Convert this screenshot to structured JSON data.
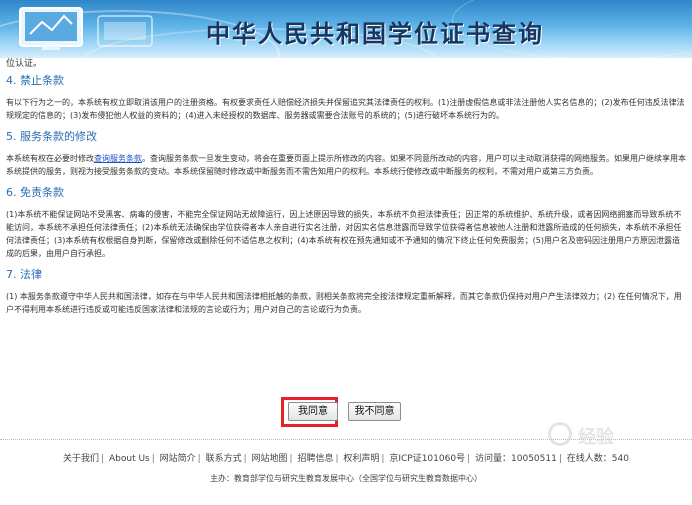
{
  "header": {
    "title": "中华人民共和国学位证书查询"
  },
  "content": {
    "top_fragment": "位认证。",
    "sections": [
      {
        "heading": "4. 禁止条款",
        "text": "有以下行为之一的，本系统有权立即取消该用户的注册资格。有权要求责任人赔偿经济损失并保留追究其法律责任的权利。(1)注册虚假信息或非法注册他人实名信息的；(2)发布任何违反法律法规规定的信息的；(3)发布侵犯他人权益的资料的；(4)进入未经授权的数据库、服务器或需要合法账号的系统的；(5)进行破坏本系统行为的。"
      },
      {
        "heading": "5. 服务条款的修改",
        "text_before_link": "本系统有权在必要时修改",
        "link": "查询服务条款",
        "text_after_link": "。查询服务条款一旦发生变动，将会在重要页面上提示所修改的内容。如果不同意所改动的内容，用户可以主动取消获得的网络服务。如果用户继续享用本系统提供的服务，则视为接受服务条款的变动。本系统保留随时修改或中断服务而不需告知用户的权利。本系统行使修改或中断服务的权利，不需对用户或第三方负责。"
      },
      {
        "heading": "6. 免责条款",
        "text": "(1)本系统不能保证网站不受黑客、病毒的侵害，不能完全保证网站无故障运行，因上述原因导致的损失，本系统不负担法律责任；因正常的系统维护、系统升级，或者因网络拥塞而导致系统不能访问，本系统不承担任何法律责任；(2)本系统无法确保由学位获得者本人亲自进行实名注册，对因实名信息泄露而导致学位获得者信息被他人注册和泄露所造成的任何损失，本系统不承担任何法律责任；(3)本系统有权根据自身判断，保留修改或删除任何不适信息之权利；(4)本系统有权在预先通知或不予通知的情况下终止任何免费服务；(5)用户名及密码因注册用户方原因泄露造成的后果，由用户自行承担。"
      },
      {
        "heading": "7. 法律",
        "text": "(1) 本服务条款遵守中华人民共和国法律，如存在与中华人民共和国法律相抵触的条款，则相关条款将完全按法律规定重新解释，而其它条款仍保持对用户产生法律效力；(2) 在任何情况下，用户不得利用本系统进行违反或可能违反国家法律和法规的言论或行为；用户对自己的言论或行为负责。"
      }
    ]
  },
  "buttons": {
    "agree": "我同意",
    "disagree": "我不同意",
    "highlight_color": "#e8202a"
  },
  "footer": {
    "links": [
      "关于我们",
      "About Us",
      "网站简介",
      "联系方式",
      "网站地图",
      "招聘信息",
      "权利声明"
    ],
    "icp": "京ICP证101060号",
    "visits_label": "访问量：",
    "visits": "10050511",
    "online_label": "在线人数：",
    "online": "540",
    "sponsor": "主办：教育部学位与研究生教育发展中心（全国学位与研究生教育数据中心）"
  },
  "watermark": {
    "text": "经验"
  },
  "colors": {
    "heading": "#2a6db4",
    "link": "#1a4fc7",
    "banner_start": "#2e86c8",
    "banner_end": "#d8eefb"
  }
}
